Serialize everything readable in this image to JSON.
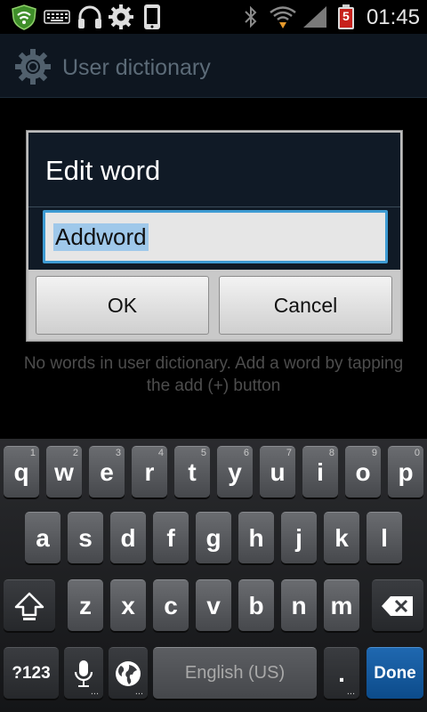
{
  "status_bar": {
    "time": "01:45",
    "battery_level": "5",
    "icons": [
      "shield-wifi-icon",
      "keyboard-icon",
      "headphones-icon",
      "gear-icon",
      "phone-icon",
      "bluetooth-icon",
      "wifi-icon",
      "signal-icon",
      "battery-icon"
    ]
  },
  "action_bar": {
    "title": "User dictionary",
    "icon": "settings-gear-icon"
  },
  "dialog": {
    "title": "Edit word",
    "input_value": "Addword",
    "ok_label": "OK",
    "cancel_label": "Cancel"
  },
  "empty_message": {
    "line1": "No words in user dictionary. Add a word by tapping",
    "line2": "the add (+) button"
  },
  "keyboard": {
    "row1": [
      {
        "label": "q",
        "num": "1"
      },
      {
        "label": "w",
        "num": "2"
      },
      {
        "label": "e",
        "num": "3"
      },
      {
        "label": "r",
        "num": "4"
      },
      {
        "label": "t",
        "num": "5"
      },
      {
        "label": "y",
        "num": "6"
      },
      {
        "label": "u",
        "num": "7"
      },
      {
        "label": "i",
        "num": "8"
      },
      {
        "label": "o",
        "num": "9"
      },
      {
        "label": "p",
        "num": "0"
      }
    ],
    "row2": [
      "a",
      "s",
      "d",
      "f",
      "g",
      "h",
      "j",
      "k",
      "l"
    ],
    "row3": [
      "z",
      "x",
      "c",
      "v",
      "b",
      "n",
      "m"
    ],
    "symbols_label": "?123",
    "period_label": ".",
    "space_label": "English (US)",
    "done_label": "Done",
    "dots": "..."
  },
  "colors": {
    "accent": "#3e9bd3",
    "done_key": "#1f68b0",
    "dialog_bg": "#101a26"
  }
}
